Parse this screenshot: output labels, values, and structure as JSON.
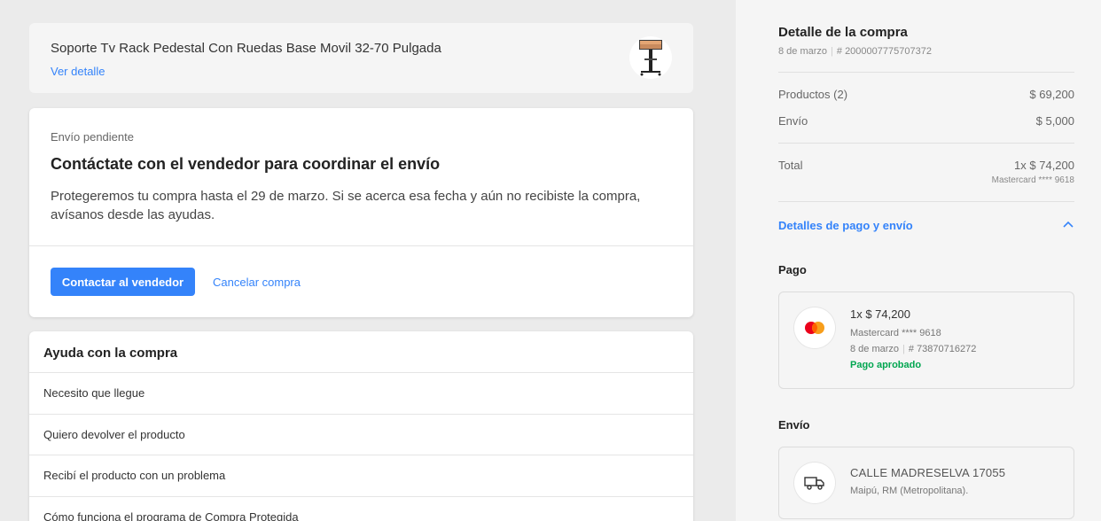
{
  "product": {
    "title": "Soporte Tv Rack Pedestal Con Ruedas Base Movil 32-70 Pulgada",
    "link_label": "Ver detalle"
  },
  "shipping_notice": {
    "status": "Envío pendiente",
    "title": "Contáctate con el vendedor para coordinar el envío",
    "description": "Protegeremos tu compra hasta el 29 de marzo. Si se acerca esa fecha y aún no recibiste la compra, avísanos desde las ayudas.",
    "primary_button": "Contactar al vendedor",
    "secondary_button": "Cancelar compra"
  },
  "help": {
    "title": "Ayuda con la compra",
    "items": [
      {
        "label": "Necesito que llegue"
      },
      {
        "label": "Quiero devolver el producto"
      },
      {
        "label": "Recibí el producto con un problema"
      },
      {
        "label": "Cómo funciona el programa de Compra Protegida"
      }
    ]
  },
  "summary": {
    "title": "Detalle de la compra",
    "date": "8 de marzo",
    "order_number": "# 2000007775707372",
    "products_label": "Productos (2)",
    "products_value": "$ 69,200",
    "shipping_label": "Envío",
    "shipping_value": "$ 5,000",
    "total_label": "Total",
    "total_value": "1x $ 74,200",
    "total_card": "Mastercard **** 9618",
    "details_toggle": "Detalles de pago y envío"
  },
  "payment": {
    "section_label": "Pago",
    "amount": "1x $ 74,200",
    "card": "Mastercard **** 9618",
    "date": "8 de marzo",
    "operation": "# 73870716272",
    "status": "Pago aprobado",
    "status_color": "#00a650"
  },
  "delivery": {
    "section_label": "Envío",
    "street": "CALLE MADRESELVA 17055",
    "city": "Maipú, RM (Metropolitana)."
  },
  "colors": {
    "accent": "#3483fa",
    "background": "#ebebeb",
    "panel": "#f5f5f5"
  },
  "icons": {
    "payment": "mastercard-icon",
    "delivery": "truck-icon",
    "toggle": "chevron-up-icon"
  }
}
